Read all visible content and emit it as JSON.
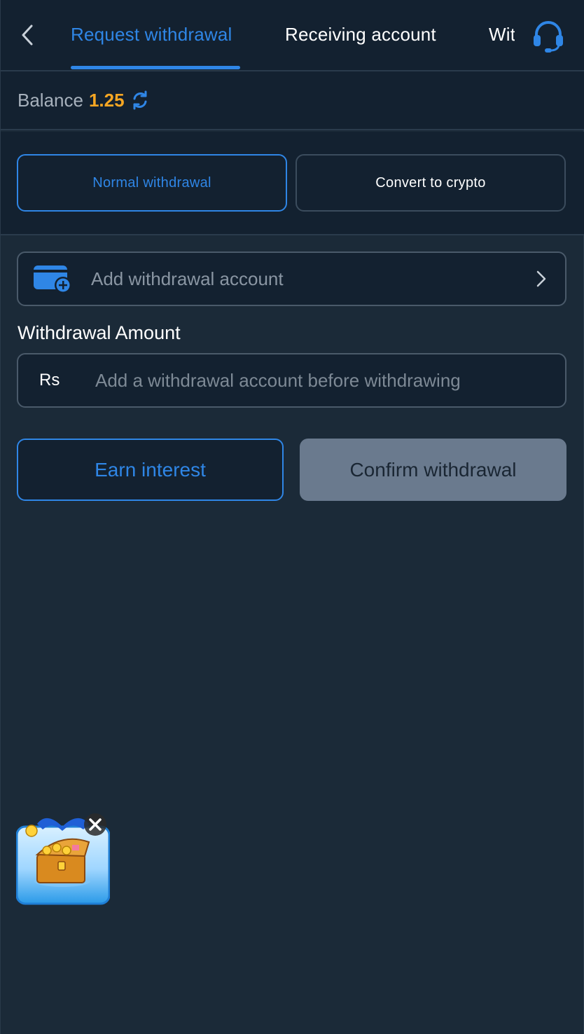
{
  "header": {
    "tabs": [
      {
        "label": "Request withdrawal",
        "active": true
      },
      {
        "label": "Receiving account",
        "active": false
      },
      {
        "label": "Withdrawal record",
        "active": false
      }
    ],
    "back_icon": "chevron-left-icon",
    "support_icon": "headset-icon"
  },
  "balance": {
    "label": "Balance",
    "value": "1.25",
    "refresh_icon": "refresh-icon"
  },
  "modes": {
    "normal_label": "Normal withdrawal",
    "crypto_label": "Convert to crypto",
    "selected": "normal"
  },
  "account": {
    "label": "Add withdrawal account",
    "icon": "wallet-add-icon"
  },
  "amount": {
    "label": "Withdrawal Amount",
    "currency": "Rs",
    "placeholder": "Add a withdrawal account before withdrawing"
  },
  "actions": {
    "earn_label": "Earn interest",
    "confirm_label": "Confirm withdrawal"
  },
  "colors": {
    "accent": "#2f86e6",
    "balance": "#f5a623",
    "background": "#1b2a38",
    "panel": "#132130",
    "disabled_button": "#6a7a8e"
  }
}
